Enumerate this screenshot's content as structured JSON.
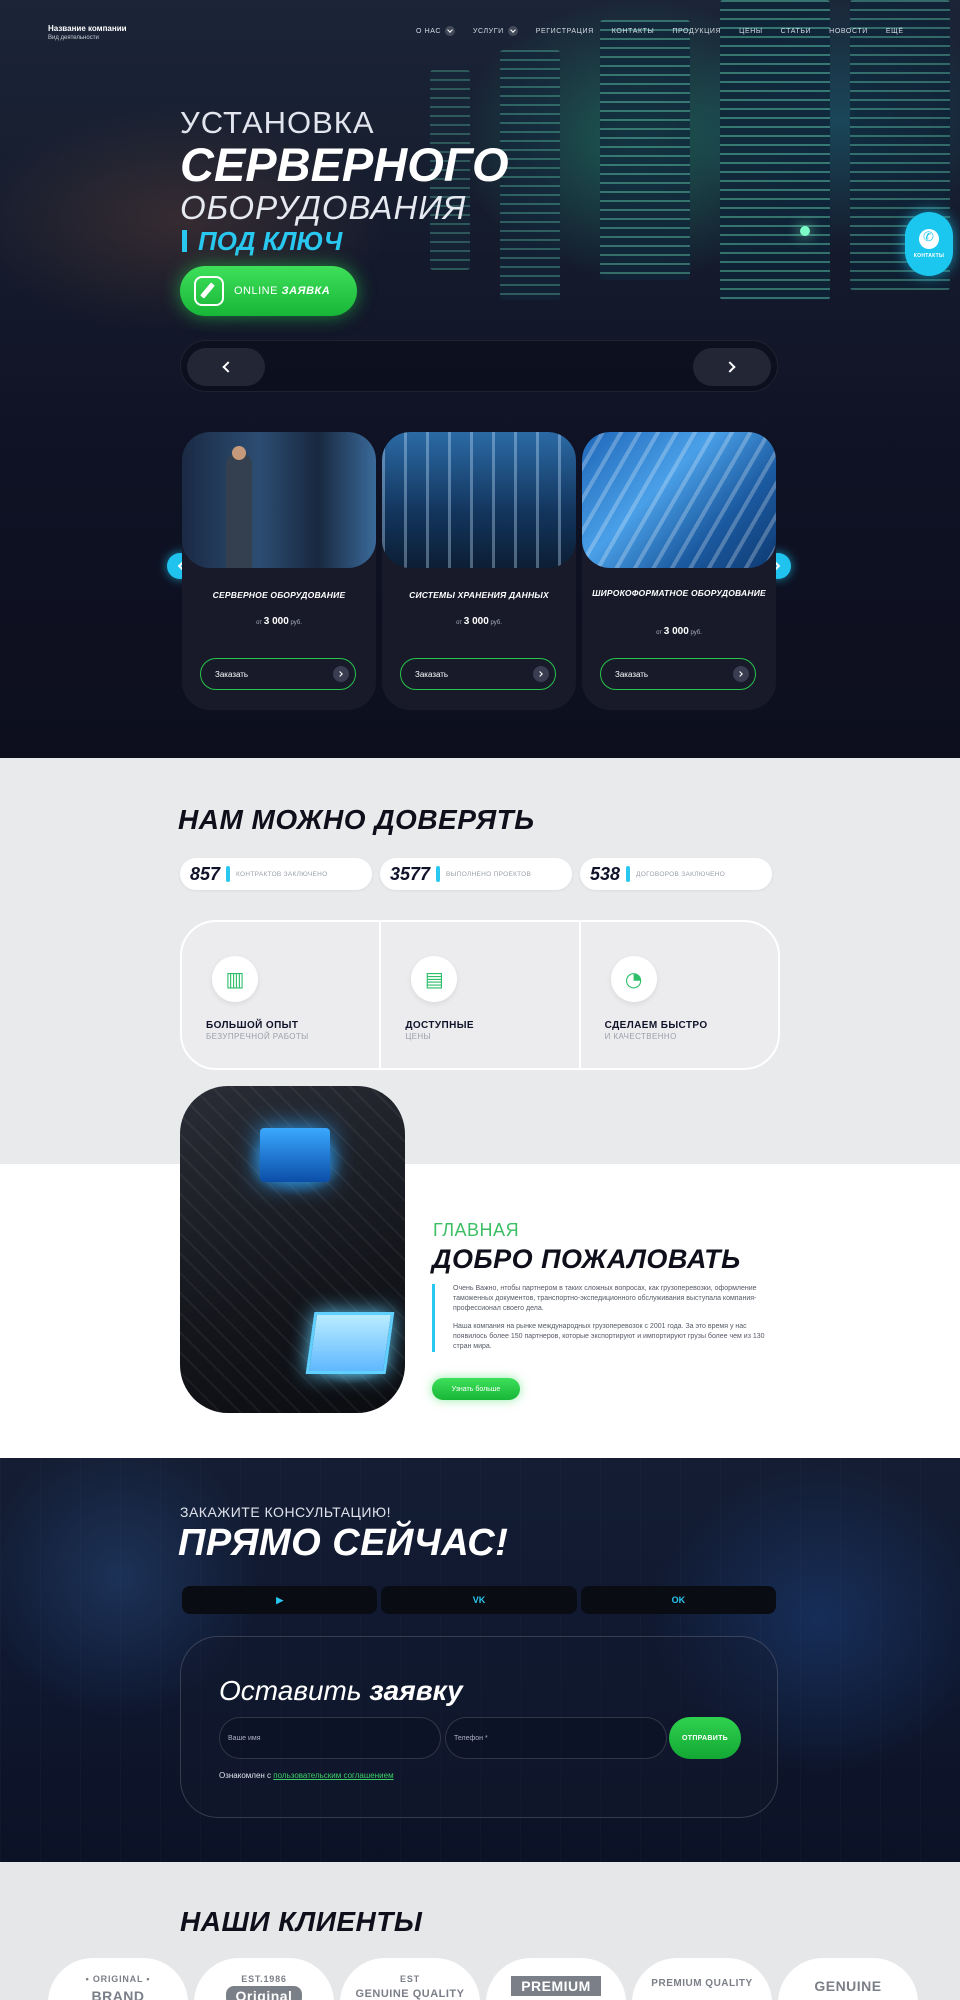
{
  "brand": {
    "name": "Название компании",
    "sub": "Вид деятельности"
  },
  "nav": {
    "items": [
      {
        "label": "О НАС",
        "dropdown": true
      },
      {
        "label": "УСЛУГИ",
        "dropdown": true
      },
      {
        "label": "РЕГИСТРАЦИЯ",
        "dropdown": false
      },
      {
        "label": "КОНТАКТЫ",
        "dropdown": false
      },
      {
        "label": "ПРОДУКЦИЯ",
        "dropdown": false
      },
      {
        "label": "ЦЕНЫ",
        "dropdown": false
      },
      {
        "label": "СТАТЬИ",
        "dropdown": false
      },
      {
        "label": "НОВОСТИ",
        "dropdown": false
      },
      {
        "label": "ЕЩЁ",
        "dropdown": false
      }
    ]
  },
  "hero": {
    "line1": "УСТАНОВКА",
    "line2": "СЕРВЕРНОГО",
    "line3": "ОБОРУДОВАНИЯ",
    "line4": "ПОД КЛЮЧ",
    "cta_prefix": "ONLINE",
    "cta_bold": "ЗАЯВКА",
    "contacts_label": "КОНТАКТЫ"
  },
  "cards": [
    {
      "title": "СЕРВЕРНОЕ ОБОРУДОВАНИЕ",
      "price_prefix": "от",
      "price": "3 000",
      "currency": "руб.",
      "button": "Заказать"
    },
    {
      "title": "СИСТЕМЫ ХРАНЕНИЯ ДАННЫХ",
      "price_prefix": "от",
      "price": "3 000",
      "currency": "руб.",
      "button": "Заказать"
    },
    {
      "title": "ШИРОКОФОРМАТНОЕ ОБОРУДОВАНИЕ",
      "price_prefix": "от",
      "price": "3 000",
      "currency": "руб.",
      "button": "Заказать"
    }
  ],
  "trust": {
    "title": "НАМ МОЖНО ДОВЕРЯТЬ",
    "stats": [
      {
        "num": "857",
        "label": "КОНТРАКТОВ ЗАКЛЮЧЕНО"
      },
      {
        "num": "3577",
        "label": "ВЫПОЛНЕНО ПРОЕКТОВ"
      },
      {
        "num": "538",
        "label": "ДОГОВОРОВ ЗАКЛЮЧЕНО"
      }
    ],
    "features": [
      {
        "title": "БОЛЬШОЙ ОПЫТ",
        "sub": "БЕЗУПРЕЧНОЙ РАБОТЫ",
        "icon": "server-rack-icon"
      },
      {
        "title": "ДОСТУПНЫЕ",
        "sub": "ЦЕНЫ",
        "icon": "server-unit-icon"
      },
      {
        "title": "СДЕЛАЕМ БЫСТРО",
        "sub": "И КАЧЕСТВЕННО",
        "icon": "gauge-icon"
      }
    ]
  },
  "welcome": {
    "kicker": "ГЛАВНАЯ",
    "title": "ДОБРО ПОЖАЛОВАТЬ",
    "p1": "Очень Важно, нтобы партнером в таких сложных вопросах, как грузоперевозки, оформление таможенных документов, транспортно-экспедиционного обслуживания выступала компания-профессионал своего дела.",
    "p2": "Наша компания на рынке международных грузоперевозок с 2001 года. За это время у нас появилось более 150 партнеров, которые экспортируют и импортируют грузы более чем из 130 стран мира.",
    "button": "Узнать больше"
  },
  "consult": {
    "kicker": "ЗАКАЖИТЕ КОНСУЛЬТАЦИЮ!",
    "title": "ПРЯМО СЕЙЧАС!",
    "socials": [
      "▶",
      "VK",
      "OK"
    ],
    "form_title_light": "Оставить",
    "form_title_bold": "заявку",
    "name_placeholder": "Ваше имя",
    "phone_placeholder": "Телефон *",
    "send": "ОТПРАВИТЬ",
    "agree_prefix": "Ознакомлен с",
    "agree_link": "пользовательским соглашением"
  },
  "clients": {
    "title": "НАШИ КЛИЕНТЫ",
    "logos": [
      {
        "top": "• ORIGINAL •",
        "main": "BRAND"
      },
      {
        "top": "EST.1986",
        "main": "Original"
      },
      {
        "top": "EST",
        "main": "GENUINE QUALITY"
      },
      {
        "top": "",
        "main": "PREMIUM"
      },
      {
        "top": "",
        "main": "PREMIUM QUALITY"
      },
      {
        "top": "",
        "main": "GENUINE"
      }
    ]
  },
  "colors": {
    "accent_green": "#27c34a",
    "accent_cyan": "#29c8f0",
    "dark_bg": "#0d0f1e"
  }
}
